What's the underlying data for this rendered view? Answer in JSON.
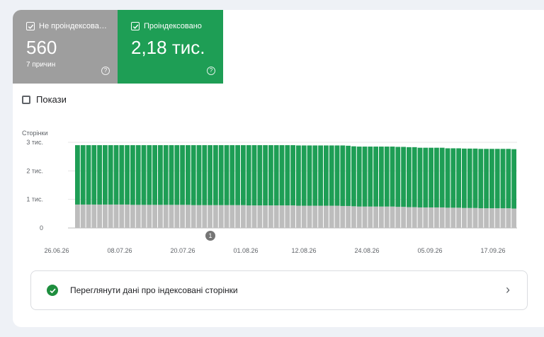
{
  "tiles": {
    "not_indexed": {
      "label": "Не проіндексова…",
      "value": "560",
      "sub": "7 причин",
      "color": "#9e9e9e",
      "checked": true
    },
    "indexed": {
      "label": "Проіндексовано",
      "value": "2,18 тис.",
      "color": "#1e9e55",
      "checked": true
    }
  },
  "impressions": {
    "label": "Покази",
    "checked": false
  },
  "chart": {
    "ylabel": "Сторінки",
    "annotation": "1"
  },
  "chart_data": {
    "type": "bar",
    "stacked": true,
    "ylabel": "Сторінки",
    "yticks": [
      "0",
      "1 тис.",
      "2 тис.",
      "3 тис."
    ],
    "ylim": [
      0,
      3000
    ],
    "xticks": [
      "26.06.26",
      "08.07.26",
      "20.07.26",
      "01.08.26",
      "12.08.26",
      "24.08.26",
      "05.09.26",
      "17.09.26"
    ],
    "grid": true,
    "legend": "none",
    "series": [
      {
        "name": "Не проіндексова…",
        "color": "#bdbdbd",
        "values": [
          820,
          820,
          820,
          820,
          820,
          820,
          820,
          820,
          820,
          820,
          810,
          810,
          810,
          810,
          810,
          810,
          810,
          810,
          810,
          810,
          810,
          800,
          800,
          800,
          800,
          800,
          800,
          800,
          800,
          800,
          800,
          790,
          790,
          790,
          790,
          790,
          790,
          790,
          790,
          790,
          780,
          780,
          780,
          780,
          780,
          780,
          780,
          780,
          770,
          770,
          760,
          750,
          750,
          750,
          750,
          750,
          750,
          750,
          740,
          740,
          730,
          730,
          720,
          720,
          720,
          720,
          720,
          710,
          710,
          710,
          700,
          700,
          700,
          690,
          690,
          690,
          690,
          690,
          690,
          680
        ]
      },
      {
        "name": "Проіндексовано",
        "color": "#1e9e55",
        "values": [
          2080,
          2080,
          2080,
          2080,
          2080,
          2080,
          2080,
          2080,
          2080,
          2080,
          2090,
          2090,
          2090,
          2090,
          2090,
          2090,
          2090,
          2090,
          2090,
          2090,
          2090,
          2100,
          2100,
          2100,
          2100,
          2100,
          2100,
          2100,
          2100,
          2100,
          2100,
          2110,
          2110,
          2110,
          2110,
          2110,
          2110,
          2110,
          2110,
          2110,
          2110,
          2110,
          2110,
          2110,
          2110,
          2110,
          2110,
          2110,
          2120,
          2110,
          2100,
          2100,
          2100,
          2100,
          2100,
          2100,
          2100,
          2100,
          2100,
          2100,
          2100,
          2100,
          2090,
          2090,
          2090,
          2090,
          2090,
          2080,
          2080,
          2080,
          2080,
          2080,
          2080,
          2080,
          2080,
          2080,
          2080,
          2080,
          2080,
          2080
        ]
      }
    ]
  },
  "link": {
    "text": "Переглянути дані про індексовані сторінки",
    "chevron": "›"
  }
}
